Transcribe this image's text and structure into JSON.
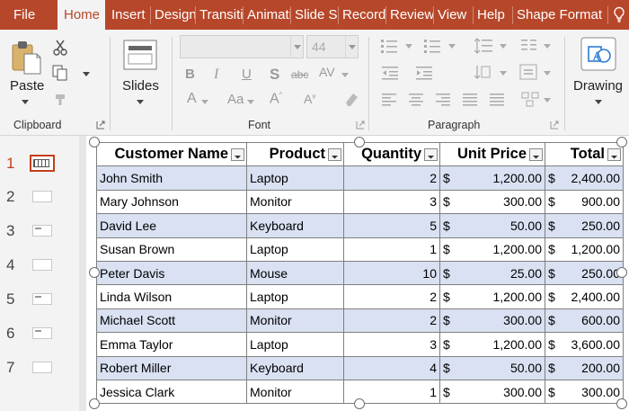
{
  "tabs": [
    {
      "label": "File",
      "selected": false
    },
    {
      "label": "Home",
      "selected": true
    },
    {
      "label": "Insert",
      "selected": false
    },
    {
      "label": "Design",
      "selected": false
    },
    {
      "label": "Transitions",
      "selected": false
    },
    {
      "label": "Animations",
      "selected": false
    },
    {
      "label": "Slide Show",
      "selected": false
    },
    {
      "label": "Record",
      "selected": false
    },
    {
      "label": "Review",
      "selected": false
    },
    {
      "label": "View",
      "selected": false
    },
    {
      "label": "Help",
      "selected": false
    },
    {
      "label": "Shape Format",
      "selected": false
    }
  ],
  "tell_me_icon": "lightbulb-icon",
  "ribbon": {
    "clipboard": {
      "group_label": "Clipboard",
      "paste_label": "Paste"
    },
    "slides": {
      "label": "Slides"
    },
    "font": {
      "group_label": "Font",
      "font_name": "",
      "font_size": "44"
    },
    "paragraph": {
      "group_label": "Paragraph"
    },
    "drawing": {
      "label": "Drawing"
    }
  },
  "thumbnails": [
    {
      "number": "1",
      "selected": true
    },
    {
      "number": "2",
      "selected": false
    },
    {
      "number": "3",
      "selected": false
    },
    {
      "number": "4",
      "selected": false
    },
    {
      "number": "5",
      "selected": false
    },
    {
      "number": "6",
      "selected": false
    },
    {
      "number": "7",
      "selected": false
    }
  ],
  "table": {
    "headers": [
      "Customer Name",
      "Product",
      "Quantity",
      "Unit Price",
      "Total"
    ],
    "currency": "$",
    "rows": [
      {
        "name": "John Smith",
        "product": "Laptop",
        "quantity": "2",
        "unit_price": "1,200.00",
        "total": "2,400.00"
      },
      {
        "name": "Mary Johnson",
        "product": "Monitor",
        "quantity": "3",
        "unit_price": "300.00",
        "total": "900.00"
      },
      {
        "name": "David Lee",
        "product": "Keyboard",
        "quantity": "5",
        "unit_price": "50.00",
        "total": "250.00"
      },
      {
        "name": "Susan Brown",
        "product": "Laptop",
        "quantity": "1",
        "unit_price": "1,200.00",
        "total": "1,200.00"
      },
      {
        "name": "Peter Davis",
        "product": "Mouse",
        "quantity": "10",
        "unit_price": "25.00",
        "total": "250.00"
      },
      {
        "name": "Linda Wilson",
        "product": "Laptop",
        "quantity": "2",
        "unit_price": "1,200.00",
        "total": "2,400.00"
      },
      {
        "name": "Michael Scott",
        "product": "Monitor",
        "quantity": "2",
        "unit_price": "300.00",
        "total": "600.00"
      },
      {
        "name": "Emma Taylor",
        "product": "Laptop",
        "quantity": "3",
        "unit_price": "1,200.00",
        "total": "3,600.00"
      },
      {
        "name": "Robert Miller",
        "product": "Keyboard",
        "quantity": "4",
        "unit_price": "50.00",
        "total": "200.00"
      },
      {
        "name": "Jessica Clark",
        "product": "Monitor",
        "quantity": "1",
        "unit_price": "300.00",
        "total": "300.00"
      }
    ]
  },
  "colors": {
    "accent": "#b7472a",
    "band": "#d9e1f2",
    "selection": "#c43e1c"
  }
}
